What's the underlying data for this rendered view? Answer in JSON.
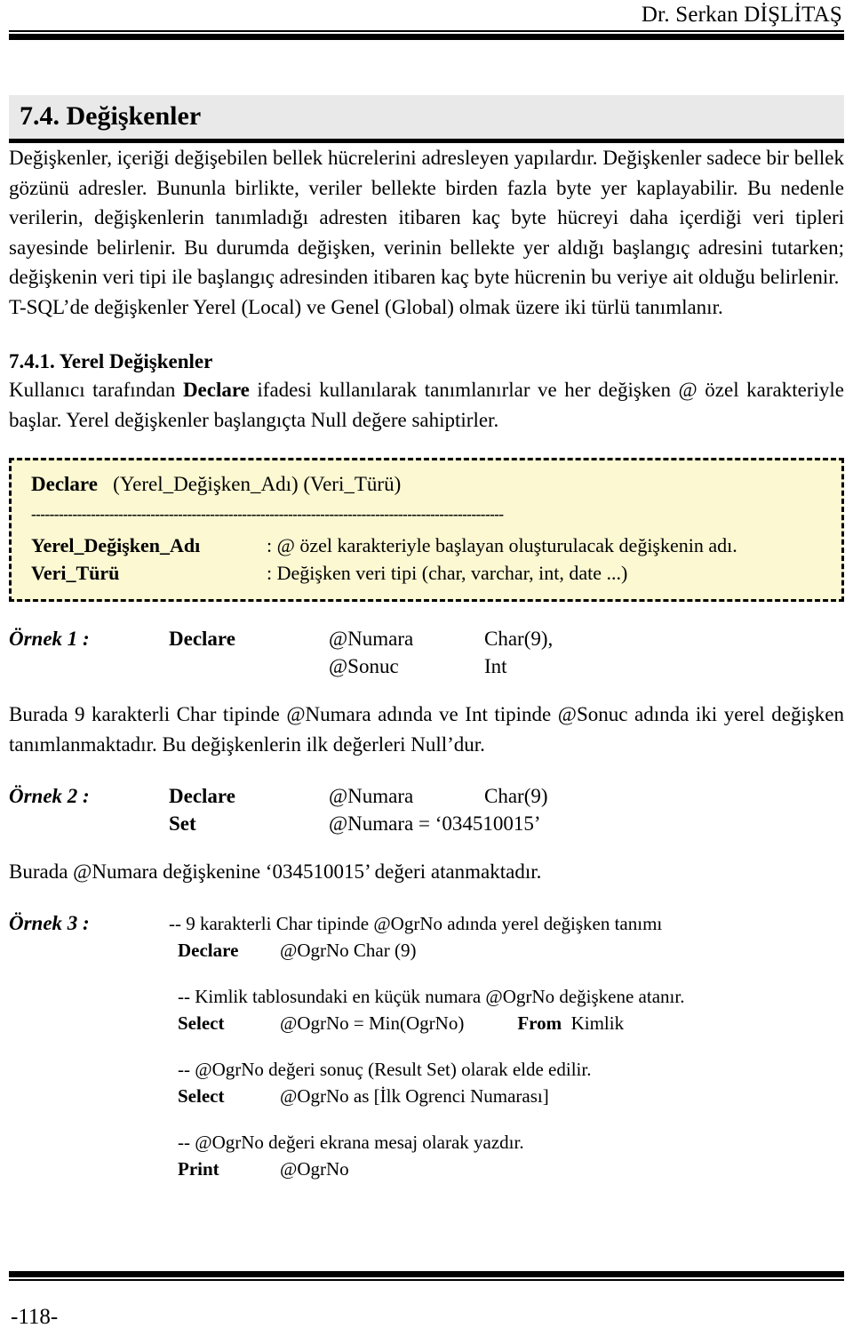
{
  "header": {
    "author": "Dr. Serkan DİŞLİTAŞ"
  },
  "heading": {
    "number_title": "7.4. Değişkenler"
  },
  "paragraphs": {
    "intro_part1": "Değişkenler, içeriği değişebilen bellek hücrelerini adresleyen yapılardır. Değişkenler sadece bir bellek gözünü adresler. Bununla birlikte, veriler bellekte birden fazla byte yer kaplayabilir. Bu nedenle verilerin, değişkenlerin tanımladığı adresten itibaren kaç byte hücreyi daha içerdiği veri tipleri sayesinde belirlenir. Bu durumda değişken, verinin bellekte yer aldığı başlangıç adresini tutarken; değişkenin veri tipi ile başlangıç adresinden itibaren kaç byte hücrenin bu veriye ait olduğu belirlenir.",
    "scope_sentence": "T-SQL’de değişkenler Yerel (Local) ve Genel (Global) olmak üzere iki türlü tanımlanır.",
    "local_intro_a": "Kullanıcı tarafından ",
    "local_intro_declare": "Declare",
    "local_intro_b": " ifadesi kullanılarak tanımlanırlar ve her değişken @ özel karakteriyle başlar. Yerel değişkenler başlangıçta Null değere sahiptirler."
  },
  "subheading": {
    "local_variables": "7.4.1. Yerel Değişkenler"
  },
  "syntax_box": {
    "keyword": "Declare",
    "signature": "(Yerel_Değişken_Adı)  (Veri_Türü)",
    "separator": "-------------------------------------------------------------------------------------------------------",
    "definitions": [
      {
        "term": "Yerel_Değişken_Adı",
        "description": ": @ özel karakteriyle başlayan oluşturulacak değişkenin adı."
      },
      {
        "term": "Veri_Türü",
        "description": ": Değişken veri tipi (char, varchar, int, date ...)"
      }
    ]
  },
  "examples": [
    {
      "label": "Örnek 1 :",
      "rows": [
        {
          "keyword": "Declare",
          "variable": "@Numara",
          "type": "Char(9),"
        },
        {
          "keyword": "",
          "variable": "@Sonuc",
          "type": "Int"
        }
      ],
      "note": "Burada 9 karakterli Char tipinde @Numara adında ve Int tipinde @Sonuc adında iki yerel değişken tanımlanmaktadır. Bu değişkenlerin ilk değerleri Null’dur."
    },
    {
      "label": "Örnek 2 :",
      "rows": [
        {
          "keyword": "Declare",
          "variable": "@Numara",
          "type": "Char(9)"
        },
        {
          "keyword": "Set",
          "variable": "@Numara = ‘034510015’",
          "type": ""
        }
      ],
      "note": "Burada @Numara değişkenine ‘034510015’ değeri atanmaktadır."
    }
  ],
  "example3": {
    "label": "Örnek 3 :",
    "lines": [
      {
        "kind": "comment",
        "text": "-- 9 karakterli Char tipinde @OgrNo adında yerel değişken tanımı"
      },
      {
        "kind": "code",
        "keyword": "Declare",
        "expr": "@OgrNo         Char (9)",
        "tail": ""
      },
      {
        "kind": "gap"
      },
      {
        "kind": "comment",
        "text": "-- Kimlik tablosundaki en küçük numara @OgrNo değişkene atanır."
      },
      {
        "kind": "code",
        "keyword": "Select",
        "expr": "@OgrNo = Min(OgrNo)",
        "tail": "From",
        "tail2": "Kimlik"
      },
      {
        "kind": "gap"
      },
      {
        "kind": "comment",
        "text": "-- @OgrNo değeri sonuç (Result Set) olarak elde edilir."
      },
      {
        "kind": "code",
        "keyword": "Select",
        "expr": "@OgrNo   as   [İlk Ogrenci Numarası]",
        "tail": ""
      },
      {
        "kind": "gap"
      },
      {
        "kind": "comment",
        "text": "-- @OgrNo değeri ekrana mesaj olarak yazdır."
      },
      {
        "kind": "code",
        "keyword": "Print",
        "expr": "@OgrNo",
        "tail": ""
      }
    ]
  },
  "footer": {
    "page_number": "-118-"
  }
}
